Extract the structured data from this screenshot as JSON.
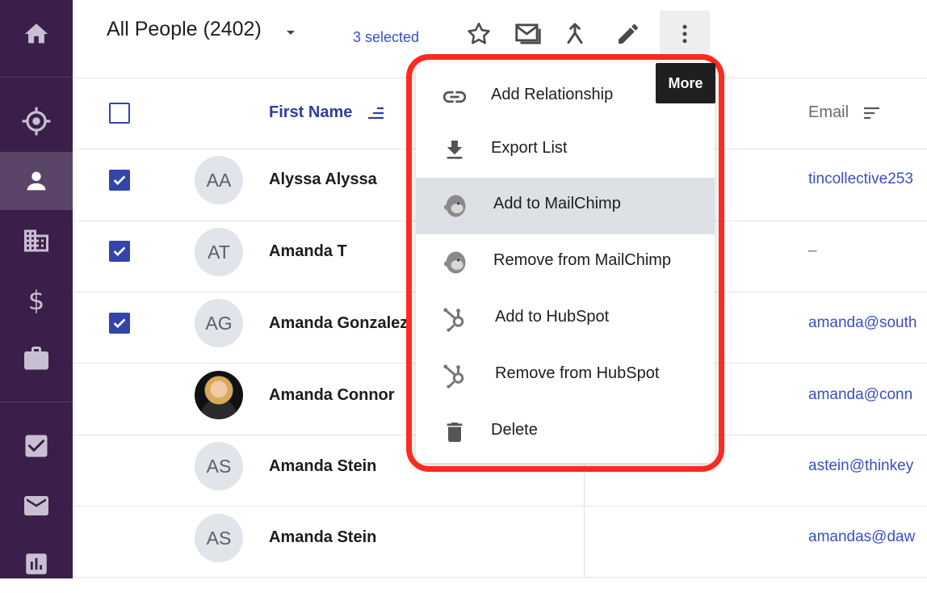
{
  "header": {
    "view_title": "All People (2402)",
    "selected_count": "3 selected"
  },
  "toolbar": {
    "tooltip": "More",
    "icons": [
      "star-icon",
      "envelope-icon",
      "merge-icon",
      "pencil-icon",
      "more-vertical-icon"
    ]
  },
  "sidebar": {
    "items": [
      "home-icon",
      "target-icon",
      "person-icon",
      "building-icon",
      "dollar-icon",
      "briefcase-icon",
      "checkbox-icon",
      "mail-icon",
      "chart-icon"
    ],
    "active": "person-icon"
  },
  "columns": {
    "first_name": "First Name",
    "email": "Email"
  },
  "rows": [
    {
      "initials": "AA",
      "name": "Alyssa Alyssa",
      "email": "tincollective253",
      "checked": true
    },
    {
      "initials": "AT",
      "name": "Amanda T",
      "email": "–",
      "checked": true
    },
    {
      "initials": "AG",
      "name": "Amanda Gonzalez",
      "email": "amanda@south",
      "checked": true
    },
    {
      "initials": "",
      "name": "Amanda Connor",
      "email": "amanda@conn",
      "checked": false
    },
    {
      "initials": "AS",
      "name": "Amanda Stein",
      "email": "astein@thinkey",
      "checked": false
    },
    {
      "initials": "AS",
      "name": "Amanda Stein",
      "email": "amandas@daw",
      "checked": false
    }
  ],
  "menu": {
    "items": [
      {
        "label": "Add Relationship",
        "icon": "link-icon"
      },
      {
        "label": "Export List",
        "icon": "download-icon"
      },
      {
        "label": "Add to MailChimp",
        "icon": "mailchimp-icon"
      },
      {
        "label": "Remove from MailChimp",
        "icon": "mailchimp-icon"
      },
      {
        "label": "Add to HubSpot",
        "icon": "hubspot-icon"
      },
      {
        "label": "Remove from HubSpot",
        "icon": "hubspot-icon"
      },
      {
        "label": "Delete",
        "icon": "trash-icon"
      }
    ],
    "highlighted_index": 2
  },
  "colors": {
    "sidebar_bg": "#3a1f4a",
    "accent_blue": "#3344aa",
    "link_blue": "#3a4fc0",
    "highlight_outline": "#ff2a1f"
  }
}
